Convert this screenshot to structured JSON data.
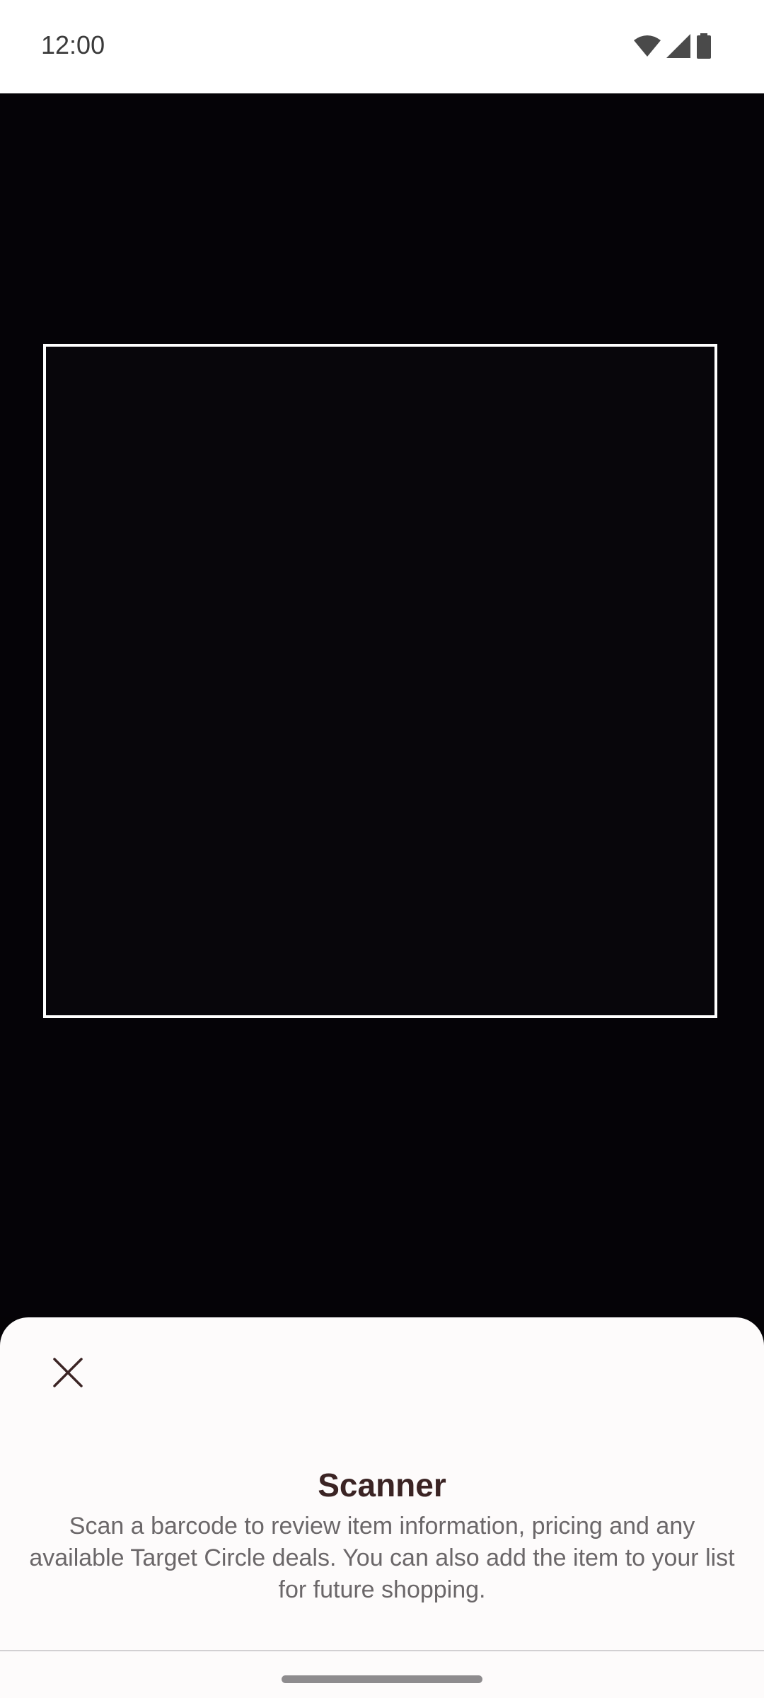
{
  "status_bar": {
    "time": "12:00",
    "icons": [
      "wifi-icon",
      "cellular-signal-icon",
      "battery-icon"
    ]
  },
  "camera": {
    "frame_color": "#ffffff"
  },
  "sheet": {
    "close_icon": "close-icon",
    "title": "Scanner",
    "description": "Scan a barcode to review item information, pricing and any available Target Circle deals. You can also add the item to your list for future shopping."
  },
  "colors": {
    "title": "#3b2424",
    "description": "#6b6769",
    "sheet_background": "#fdfbfb",
    "camera_background": "#050307"
  }
}
